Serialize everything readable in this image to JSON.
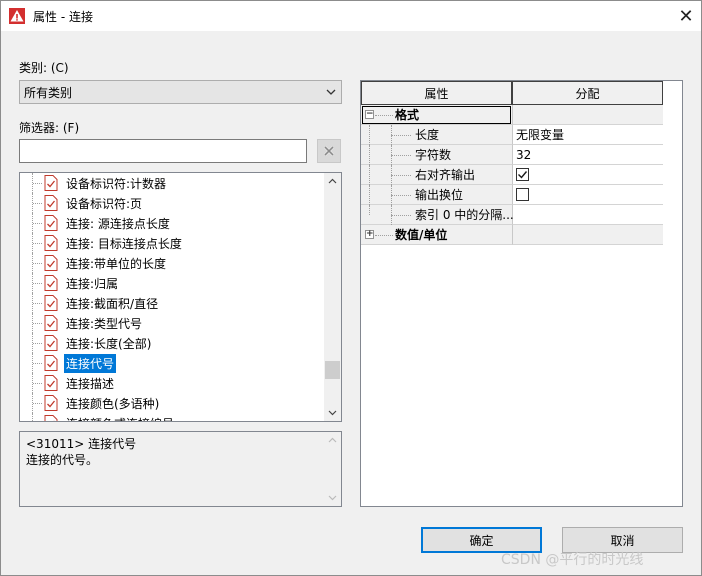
{
  "window": {
    "title": "属性 - 连接",
    "close_label": "✕"
  },
  "category": {
    "label": "类别: (C)",
    "value": "所有类别"
  },
  "filter": {
    "label": "筛选器: (F)",
    "value": "",
    "placeholder": ""
  },
  "list": {
    "items": [
      {
        "label": "设备标识符:计数器",
        "selected": false
      },
      {
        "label": "设备标识符:页",
        "selected": false
      },
      {
        "label": "连接: 源连接点长度",
        "selected": false
      },
      {
        "label": "连接: 目标连接点长度",
        "selected": false
      },
      {
        "label": "连接:带单位的长度",
        "selected": false
      },
      {
        "label": "连接:归属",
        "selected": false
      },
      {
        "label": "连接:截面积/直径",
        "selected": false
      },
      {
        "label": "连接:类型代号",
        "selected": false
      },
      {
        "label": "连接:长度(全部)",
        "selected": false
      },
      {
        "label": "连接代号",
        "selected": true
      },
      {
        "label": "连接描述",
        "selected": false
      },
      {
        "label": "连接颜色(多语种)",
        "selected": false
      },
      {
        "label": "连接颜色或连接编号",
        "selected": false
      }
    ]
  },
  "description": {
    "line1": "<31011> 连接代号",
    "line2": "连接的代号。"
  },
  "grid": {
    "col_property": "属性",
    "col_value": "分配",
    "groups": [
      {
        "label": "格式",
        "expanded": true,
        "rows": [
          {
            "label": "长度",
            "value": "无限变量",
            "type": "text"
          },
          {
            "label": "字符数",
            "value": "32",
            "type": "text"
          },
          {
            "label": "右对齐输出",
            "checked": true,
            "type": "checkbox"
          },
          {
            "label": "输出换位",
            "checked": false,
            "type": "checkbox"
          },
          {
            "label": "索引 0 中的分隔...",
            "value": "",
            "type": "text"
          }
        ]
      },
      {
        "label": "数值/单位",
        "expanded": false,
        "rows": []
      }
    ]
  },
  "buttons": {
    "ok": "确定",
    "cancel": "取消"
  },
  "watermark": "CSDN @平行的时光线"
}
